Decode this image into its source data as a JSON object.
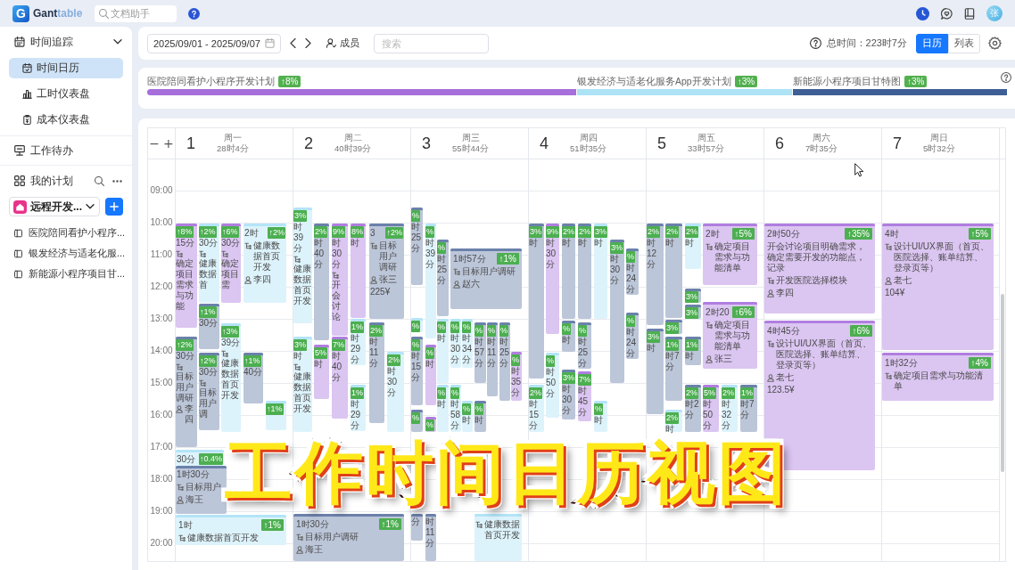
{
  "app": {
    "logo_mark": "G",
    "logo": {
      "main": "Gant",
      "accent": "table"
    },
    "doc_search": {
      "placeholder": "文档助手"
    },
    "avatar": "张"
  },
  "sidebar": {
    "time_tracking": {
      "label": "时间追踪",
      "expanded": true,
      "items": [
        {
          "label": "时间日历",
          "selected": true
        },
        {
          "label": "工时仪表盘",
          "selected": false
        },
        {
          "label": "成本仪表盘",
          "selected": false
        }
      ]
    },
    "todo": {
      "label": "工作待办"
    },
    "plans": {
      "label": "我的计划",
      "workspace": "远程开发...",
      "projects": [
        "医院陪同看护小程序...",
        "银发经济与适老化服...",
        "新能源小程序项目甘..."
      ]
    }
  },
  "toolbar": {
    "date_range": "2025/09/01 - 2025/09/07",
    "members": "成员",
    "search": {
      "placeholder": "搜索"
    },
    "total": "总时间：223时7分",
    "views": [
      {
        "label": "日历",
        "selected": true
      },
      {
        "label": "列表",
        "selected": false
      }
    ]
  },
  "projects": [
    {
      "name": "医院陪同看护小程序开发计划",
      "progress": "↑8%",
      "color": "#a66fdb"
    },
    {
      "name": "银发经济与适老化服务App开发计划",
      "progress": "↑3%",
      "color": "#ade3f5"
    },
    {
      "name": "新能源小程序项目甘特图",
      "progress": "↑3%",
      "color": "#3e5f96"
    }
  ],
  "calendar": {
    "zoom_out": "−",
    "zoom_in": "+",
    "hours": [
      "09:00",
      "10:00",
      "11:00",
      "12:00",
      "13:00",
      "14:00",
      "15:00",
      "16:00",
      "17:00",
      "18:00",
      "19:00",
      "20:00"
    ],
    "days": [
      {
        "date": "1",
        "weekday": "周一",
        "total": "28时4分",
        "events": [
          {
            "color": "#b07ee0",
            "progress": "↑8%",
            "duration": "15分",
            "task": "确定项目需求与功能"
          },
          {
            "color": "#b4e4f7",
            "progress": "↑2%",
            "duration": "30分",
            "task": "健康数据首"
          },
          {
            "color": "#b07ee0",
            "progress": "↑6%",
            "duration": "30分",
            "task": "确定项目需"
          },
          {
            "color": "#b4e4f7",
            "duration": "2时",
            "progress": "↑2%",
            "task": "健康数据首页开发",
            "person": "李四"
          },
          {
            "color": "#6b81ab",
            "progress": "↑1%",
            "duration": "30分"
          },
          {
            "color": "#6b81ab",
            "progress": "↑2%",
            "duration": "30分",
            "task": "目标用户调研",
            "person": "李四"
          },
          {
            "color": "#b4e4f7",
            "progress": "↑3%",
            "duration": "39分",
            "task": "健康数据首页开发"
          },
          {
            "color": "#6b81ab",
            "progress": "↑2%",
            "duration": "30分",
            "task": "目标用户调"
          },
          {
            "color": "#6b81ab",
            "progress": "↑1%",
            "duration": "40分"
          },
          {
            "color": "#b4e4f7",
            "progress": "↑1%"
          },
          {
            "color": "#b4e4f7",
            "duration": "30分",
            "progress": "↑0.4%"
          },
          {
            "color": "#6b81ab",
            "duration": "1时30分",
            "task": "目标用户",
            "person": "海王"
          },
          {
            "color": "#b4e4f7",
            "duration": "1时",
            "progress": "↑1%",
            "task": "健康数据首页开发"
          }
        ]
      },
      {
        "date": "2",
        "weekday": "周二",
        "total": "40时39分",
        "events": [
          {
            "color": "#b4e4f7",
            "progress": "3%",
            "duration": "时39分",
            "task": "健康数据首页开发"
          },
          {
            "color": "#6b81ab",
            "progress": "2%",
            "duration": "时40分"
          },
          {
            "color": "#b07ee0",
            "progress": "9%",
            "duration": "时30分",
            "task": "开会讨论"
          },
          {
            "color": "#b07ee0",
            "progress": "8%",
            "duration": "时"
          },
          {
            "color": "#6b81ab",
            "duration": "3",
            "progress": "↑2%",
            "task": "目标用户调研",
            "person": "张三",
            "cost": "225¥"
          },
          {
            "color": "#b4e4f7",
            "progress": "3%",
            "duration": "时",
            "task": "健康数据首页开发"
          },
          {
            "color": "#b07ee0",
            "progress": "5%",
            "duration": "时"
          },
          {
            "color": "#b07ee0",
            "progress": "7%",
            "duration": "时40分"
          },
          {
            "color": "#b4e4f7",
            "progress": "1%",
            "duration": "时29分"
          },
          {
            "color": "#6b81ab",
            "progress": "2%",
            "duration": "时11分"
          },
          {
            "color": "#b4e4f7",
            "progress": "2%",
            "duration": "时30分"
          },
          {
            "color": "#b4e4f7",
            "progress": "1%",
            "duration": "时29分"
          },
          {
            "color": "#6b81ab",
            "duration": "1时30分",
            "progress": "↑1%",
            "task": "目标用户调研",
            "person": "海王"
          }
        ]
      },
      {
        "date": "3",
        "weekday": "周三",
        "total": "55时44分",
        "events": [
          {
            "color": "#6b81ab",
            "progress": "%",
            "duration": "时25分"
          },
          {
            "color": "#b4e4f7",
            "progress": "%",
            "duration": "时39分"
          },
          {
            "color": "#6b81ab",
            "progress": "%",
            "duration": "时25分"
          },
          {
            "color": "#6b81ab",
            "duration": "1时57分",
            "progress": "↑1%",
            "task": "目标用户调研",
            "person": "赵六"
          },
          {
            "color": "#b4e4f7",
            "progress": "%"
          },
          {
            "color": "#6b81ab",
            "progress": "%",
            "duration": "时15分"
          },
          {
            "color": "#b07ee0",
            "progress": "%",
            "duration": "时"
          },
          {
            "color": "#b4e4f7",
            "progress": "%",
            "duration": "时"
          },
          {
            "color": "#b4e4f7",
            "progress": "%",
            "duration": "时30分"
          },
          {
            "color": "#b4e4f7",
            "progress": "%",
            "duration": "时34分"
          },
          {
            "color": "#6b81ab",
            "progress": "%",
            "duration": "时57分"
          },
          {
            "color": "#6b81ab",
            "progress": "%",
            "duration": "时11分"
          },
          {
            "color": "#6b81ab",
            "progress": "%",
            "duration": "时25分"
          },
          {
            "color": "#b07ee0",
            "progress": "%",
            "duration": "时35分"
          },
          {
            "color": "#6b81ab",
            "progress": "%"
          },
          {
            "color": "#b07ee0",
            "progress": "%"
          },
          {
            "color": "#b4e4f7",
            "progress": "%",
            "duration": "时"
          },
          {
            "color": "#b4e4f7",
            "progress": "%",
            "duration": "时58分"
          },
          {
            "color": "#b4e4f7",
            "progress": "%",
            "duration": "时"
          },
          {
            "color": "#6b81ab",
            "progress": "%",
            "duration": "时"
          },
          {
            "color": "#6b81ab",
            "duration": "分"
          },
          {
            "color": "#6b81ab",
            "duration": "时11分"
          },
          {
            "color": "#b4e4f7",
            "task": "健康数据首页开发"
          }
        ]
      },
      {
        "date": "4",
        "weekday": "周四",
        "total": "51时35分",
        "events": [
          {
            "color": "#6b81ab",
            "progress": "3%",
            "duration": "时"
          },
          {
            "color": "#b07ee0",
            "progress": "9%",
            "duration": "时30分"
          },
          {
            "color": "#6b81ab",
            "progress": "2%",
            "duration": "时"
          },
          {
            "color": "#6b81ab",
            "progress": "2%",
            "duration": "时"
          },
          {
            "color": "#b4e4f7",
            "progress": "3%",
            "duration": "时"
          },
          {
            "color": "#6b81ab",
            "progress": "3%",
            "duration": "时30分"
          },
          {
            "color": "#6b81ab",
            "progress": "%",
            "duration": "时24分"
          },
          {
            "color": "#6b81ab",
            "progress": "%",
            "duration": "时"
          },
          {
            "color": "#6b81ab",
            "progress": "%",
            "duration": "时25分"
          },
          {
            "color": "#6b81ab",
            "progress": "%",
            "duration": "时24分"
          },
          {
            "color": "#b4e4f7",
            "progress": "%",
            "duration": "时50分"
          },
          {
            "color": "#b4e4f7",
            "progress": "2%",
            "duration": "时15分"
          },
          {
            "color": "#6b81ab",
            "progress": "3%",
            "duration": "时30分"
          },
          {
            "color": "#b07ee0",
            "progress": "7%",
            "duration": "时45分"
          },
          {
            "color": "#b4e4f7",
            "progress": "%",
            "duration": "时"
          }
        ]
      },
      {
        "date": "5",
        "weekday": "周五",
        "total": "33时57分",
        "events": [
          {
            "color": "#6b81ab",
            "progress": "2%",
            "duration": "时12分"
          },
          {
            "color": "#6b81ab",
            "progress": "2%",
            "duration": "时"
          },
          {
            "color": "#b4e4f7",
            "progress": "2%",
            "duration": "时"
          },
          {
            "color": "#b07ee0",
            "duration": "2时",
            "progress": "↑5%",
            "task": "确定项目需求与功能清单"
          },
          {
            "color": "#6b81ab",
            "progress": "3%"
          },
          {
            "color": "#6b81ab",
            "progress": "3%",
            "duration": "时"
          },
          {
            "color": "#6b81ab",
            "progress": "3%"
          },
          {
            "color": "#6b81ab",
            "progress": "3%"
          },
          {
            "color": "#b07ee0",
            "duration": "2时20",
            "progress": "↑6%",
            "task": "确定项目需求与功能清单",
            "person": "张三"
          },
          {
            "color": "#6b81ab",
            "progress": "1%",
            "duration": "时7分"
          },
          {
            "color": "#6b81ab",
            "progress": "1%",
            "duration": "时"
          },
          {
            "color": "#b4e4f7",
            "progress": "2%",
            "duration": "时"
          },
          {
            "color": "#6b81ab",
            "progress": "2%",
            "duration": "时2分"
          },
          {
            "color": "#b07ee0",
            "progress": "5%",
            "duration": "时50分"
          },
          {
            "color": "#b4e4f7",
            "progress": "2%",
            "duration": "时32分"
          },
          {
            "color": "#6b81ab",
            "progress": "1%",
            "duration": "时7分"
          }
        ]
      },
      {
        "date": "6",
        "weekday": "周六",
        "total": "7时35分",
        "events": [
          {
            "color": "#b07ee0",
            "duration": "2时50分",
            "progress": "↑35%",
            "note": "开会讨论项目明确需求，确定需要开发的功能点，记录",
            "task": "开发医院选择模块",
            "person": "李四"
          },
          {
            "color": "#b07ee0",
            "duration": "4时45分",
            "progress": "↑6%",
            "task": "设计UI/UX界面（首页、医院选择、账单结算、登录页等）",
            "person": "老七",
            "cost": "123.5¥"
          }
        ]
      },
      {
        "date": "7",
        "weekday": "周日",
        "total": "5时32分",
        "events": [
          {
            "color": "#b07ee0",
            "duration": "4时",
            "progress": "↑5%",
            "task": "设计UI/UX界面（首页、医院选择、账单结算、登录页等）",
            "person": "老七",
            "cost": "104¥"
          },
          {
            "color": "#b07ee0",
            "duration": "1时32分",
            "progress": "↑4%",
            "task": "确定项目需求与功能清单"
          }
        ]
      }
    ]
  },
  "caption": "工作时间日历视图"
}
